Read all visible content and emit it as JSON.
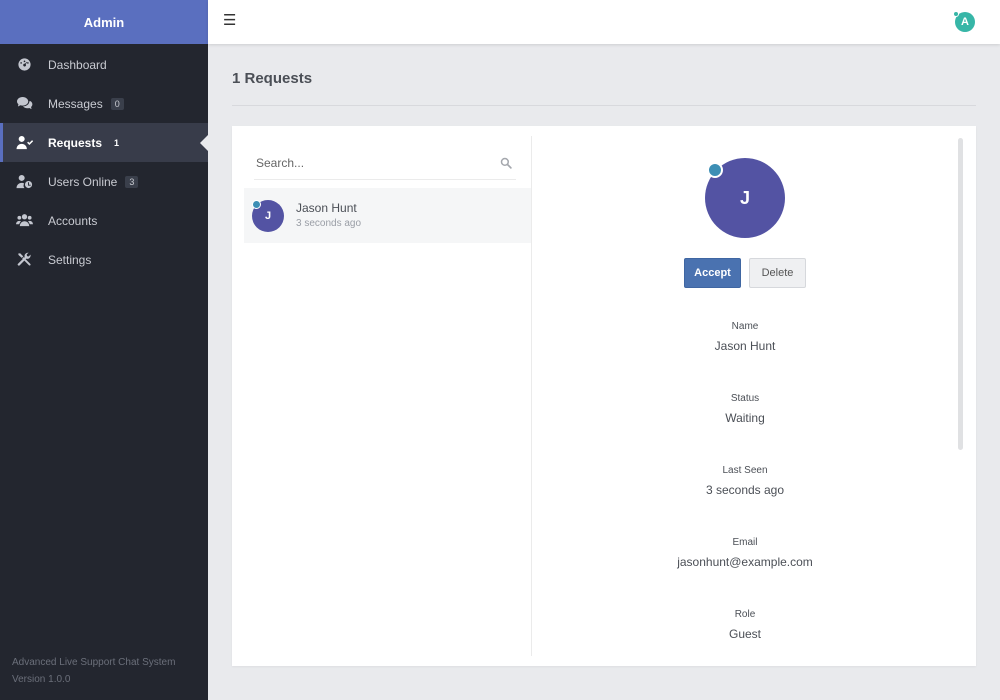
{
  "sidebar": {
    "brand": "Admin",
    "items": [
      {
        "label": "Dashboard",
        "badge": "",
        "icon": "dashboard-icon"
      },
      {
        "label": "Messages",
        "badge": "0",
        "icon": "comments-icon"
      },
      {
        "label": "Requests",
        "badge": "1",
        "icon": "user-check-icon",
        "active": true
      },
      {
        "label": "Users Online",
        "badge": "3",
        "icon": "user-clock-icon"
      },
      {
        "label": "Accounts",
        "badge": "",
        "icon": "users-icon"
      },
      {
        "label": "Settings",
        "badge": "",
        "icon": "tools-icon"
      }
    ],
    "footer": {
      "line1": "Advanced Live Support Chat System",
      "line2": "Version 1.0.0"
    }
  },
  "topbar": {
    "menu_icon": "hamburger-icon",
    "user_initial": "A"
  },
  "page": {
    "title": "1 Requests"
  },
  "search": {
    "placeholder": "Search...",
    "icon": "search-icon"
  },
  "requests": [
    {
      "initial": "J",
      "name": "Jason Hunt",
      "time": "3 seconds ago"
    }
  ],
  "detail": {
    "initial": "J",
    "accept_label": "Accept",
    "delete_label": "Delete",
    "fields": [
      {
        "label": "Name",
        "value": "Jason Hunt"
      },
      {
        "label": "Status",
        "value": "Waiting"
      },
      {
        "label": "Last Seen",
        "value": "3 seconds ago"
      },
      {
        "label": "Email",
        "value": "jasonhunt@example.com"
      },
      {
        "label": "Role",
        "value": "Guest"
      }
    ]
  },
  "colors": {
    "brand": "#5a6fbf",
    "sidebar_bg": "#23262f",
    "avatar": "#5353a3",
    "online_dot": "#3d8fb5",
    "accept": "#4a72b0",
    "user_avatar": "#37b6a7"
  }
}
